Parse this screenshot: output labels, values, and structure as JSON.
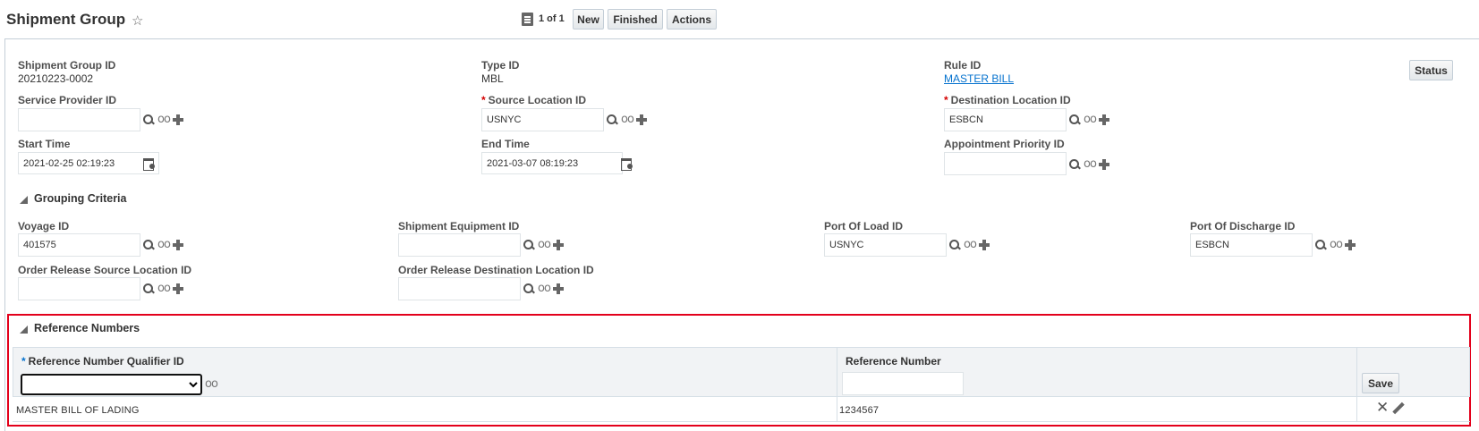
{
  "header": {
    "title": "Shipment Group",
    "pager": "1 of 1",
    "buttons": {
      "new": "New",
      "finished": "Finished",
      "actions": "Actions"
    }
  },
  "status_button": "Status",
  "fields": {
    "shipment_group_id": {
      "label": "Shipment Group ID",
      "value": "20210223-0002"
    },
    "type_id": {
      "label": "Type ID",
      "value": "MBL"
    },
    "rule_id": {
      "label": "Rule ID",
      "value": "MASTER BILL"
    },
    "service_provider_id": {
      "label": "Service Provider ID",
      "value": ""
    },
    "source_location_id": {
      "label": "Source Location ID",
      "value": "USNYC",
      "required": "*"
    },
    "destination_location_id": {
      "label": "Destination Location ID",
      "value": "ESBCN",
      "required": "*"
    },
    "start_time": {
      "label": "Start Time",
      "value": "2021-02-25 02:19:23"
    },
    "end_time": {
      "label": "End Time",
      "value": "2021-03-07 08:19:23"
    },
    "appointment_priority_id": {
      "label": "Appointment Priority ID",
      "value": ""
    }
  },
  "grouping_criteria": {
    "title": "Grouping Criteria",
    "voyage_id": {
      "label": "Voyage ID",
      "value": "401575"
    },
    "shipment_equipment_id": {
      "label": "Shipment Equipment ID",
      "value": ""
    },
    "port_of_load_id": {
      "label": "Port Of Load ID",
      "value": "USNYC"
    },
    "port_of_discharge_id": {
      "label": "Port Of Discharge ID",
      "value": "ESBCN"
    },
    "order_release_source_location_id": {
      "label": "Order Release Source Location ID",
      "value": ""
    },
    "order_release_destination_location_id": {
      "label": "Order Release Destination Location ID",
      "value": ""
    }
  },
  "reference_numbers": {
    "title": "Reference Numbers",
    "columns": {
      "qualifier": "Reference Number Qualifier ID",
      "qualifier_required": "*",
      "number": "Reference Number"
    },
    "new_row": {
      "qualifier": "",
      "number": "",
      "save_label": "Save"
    },
    "rows": [
      {
        "qualifier": "MASTER BILL OF LADING",
        "number": "1234567"
      }
    ]
  },
  "icons": {
    "favorite": "star-icon",
    "pager": "page-icon",
    "search": "search-icon",
    "view": "view-glasses-icon",
    "add": "add-plus-icon",
    "calendar": "calendar-icon",
    "edit": "edit-pencil-icon",
    "delete": "delete-x-icon"
  },
  "colors": {
    "highlight_border": "#e3001b",
    "required_marker": "#d40000",
    "link": "#0572ce"
  }
}
